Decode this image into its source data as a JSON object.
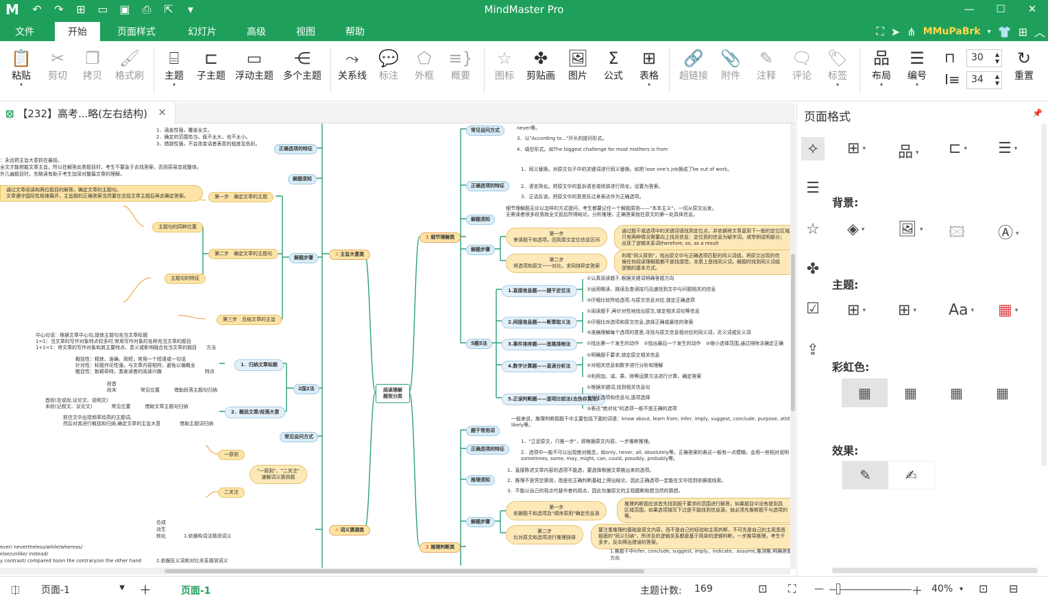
{
  "app": {
    "title": "MindMaster Pro",
    "logo": "M"
  },
  "quick_access": [
    {
      "icon": "undo-icon",
      "glyph": "↶"
    },
    {
      "icon": "redo-icon",
      "glyph": "↷"
    },
    {
      "icon": "new-icon",
      "glyph": "⊞"
    },
    {
      "icon": "open-folder-icon",
      "glyph": "🗀"
    },
    {
      "icon": "save-icon",
      "glyph": "🖫"
    },
    {
      "icon": "print-icon",
      "glyph": "⎙"
    },
    {
      "icon": "export-icon",
      "glyph": "⇱"
    },
    {
      "icon": "more-icon",
      "glyph": "▾"
    }
  ],
  "menu": {
    "file": "文件",
    "home": "开始",
    "page_style": "页面样式",
    "slides": "幻灯片",
    "advanced": "高级",
    "view": "视图",
    "help": "帮助"
  },
  "user": {
    "name": "MMuPaBrk"
  },
  "ribbon": {
    "paste": "粘贴",
    "cut": "剪切",
    "copy": "拷贝",
    "format_painter": "格式刷",
    "topic": "主题",
    "subtopic": "子主题",
    "floating_topic": "浮动主题",
    "multiple_topics": "多个主题",
    "relationship": "关系线",
    "callout": "标注",
    "boundary": "外框",
    "summary": "概要",
    "icon": "图标",
    "clipart": "剪贴画",
    "image": "图片",
    "formula": "公式",
    "table": "表格",
    "hyperlink": "超链接",
    "attachment": "附件",
    "note": "注释",
    "comment": "评论",
    "tag": "标签",
    "layout": "布局",
    "numbering": "编号",
    "spacing_h": "30",
    "spacing_v": "34",
    "reset": "重置"
  },
  "tab": {
    "title": "【232】高考...略(左右结构)"
  },
  "panel": {
    "title": "页面格式",
    "background": "背景:",
    "theme": "主题:",
    "rainbow": "彩虹色:",
    "effects": "效果:"
  },
  "status": {
    "page_name": "页面-1",
    "active_page": "页面-1",
    "topic_count_label": "主题计数:",
    "topic_count": "169",
    "zoom": "40%"
  },
  "mindmap": {
    "center": "阅读理解\n题型分类",
    "left_main": [
      {
        "label": "主旨大意类",
        "num": "3"
      },
      {
        "label": "词义猜测类",
        "num": "4"
      }
    ],
    "right_main": [
      {
        "label": "细节理解类",
        "num": "1"
      },
      {
        "label": "推理判断类",
        "num": "2"
      }
    ],
    "left_nodes": {
      "features": "正确选项的特征",
      "notes": "解题须知",
      "steps": "解题步骤",
      "step1": "第一步　确定文章的主题",
      "step2": "第二步　确定文章的主题句",
      "step3": "第三步　总结文章的主旨",
      "pos4": "主题句的四种位置",
      "feat": "主题句的特征",
      "method22": "2国2法",
      "m1": "1．归纳文章标题",
      "m2": "2．概括文章/段落大意",
      "common": "常见设问方式",
      "one_two": "\"一原则\"、\"二关注\"\n速解词义猜测题",
      "principle": "一原则",
      "focus": "二关注",
      "clue1": "1.依据构词法猜测词义",
      "clue2": "2.依据反义词和对比关系猜测词义"
    },
    "right_nodes": {
      "common": "常见设问方式",
      "features": "正确选项的特征",
      "notes": "解题须知",
      "steps": "解题步骤",
      "s1": "第一步\n审读题干和选项，回到原文定位信息区间",
      "s2": "第二步\n将选项和原文一一对比，求同排异定答案",
      "five": "5题5法",
      "f1": "1.直接信息题——题干定位法",
      "f2": "2.间接信息题——断章取义法",
      "f3": "3.事件排序题——首尾排除法",
      "f4": "4.数字计算题——直读分析法",
      "f5": "5.正误判断题——逐项比较法(去伪存真法)",
      "words": "题干常用词",
      "features2": "正确选项的特征",
      "notes2": "推理须知",
      "steps2": "解题步骤",
      "t1": "第一步\n依据题干和选项及\"顺序原则\"确定信息源",
      "t2": "第二步\n比对原文和选项进行推理抉择"
    },
    "text_snippets": {
      "l1": "1．涵盖性强，覆盖全文。",
      "l2": "2．确定的范围恰当，既不太大，也不太小。",
      "l3": "3．措辞性强，不会改变话者表意的程度及色彩。",
      "l4": "：永远把主旨大意抓在最前。",
      "l5": "全文才能把握文章主旨，所以在解答此类题目时，考生不要急于去找答案，否则容易忽视整体。",
      "l6": "外几遍题目时，先略读有助于考生加深对整篇文章的理解。",
      "l7": "通过文章阅读和两位题目的解答，确定文章的主题句。",
      "l8": "文章遵守国际性规律展开，主旨题的正确答案当然要在总括文章主题后再去确定答案。",
      "l9": "中心句话：根据文章中心句,提炼主题句充当文章标题",
      "l10": "1=1：当文章的写作对象特点较多时,常用写作对象的名称充当文章的题目",
      "l11": "1+1=1：将文章的写作对象和其主要特点、意义或影响融合充当文章的题目　　方法",
      "l12": "概括性：精炼、准确、简短，常用一个短语或一句话",
      "l13": "针对性：标题作论性强，与文章内容相符，避免以偏概全",
      "l14": "醒目性：新颖奇特，激发读者的阅读兴趣　　　　　　　　　特点",
      "l15": "段首　　",
      "l16": "段末　　　　　常见位置　　　借助段落主题句归纳",
      "l17": "首段(总说段,议论文、说明文)",
      "l18": "末段(记叙文、议论文)　　　　常见位置　　　借助文章主题句归纳",
      "l19": "抓住文中出现频率较高的主题词,",
      "l20": "然后对其进行概括和归纳,确定文章的主旨大意　　　　借助主题词归纳",
      "l21": "合成",
      "l22": "派生",
      "l23": "转化",
      "l24": "ever/ nevertheless/while/whereas/",
      "l25": "else/unlike/ instead/",
      "l26": "y contrast/ compared to/on the contrary/on the other hand"
    },
    "right_snippets": {
      "r1": "never等。",
      "r2": "3．以\"According to...\"开头的提问形式。",
      "r3": "4．填空形式。如The biggest challenge for most mothers is from",
      "r4": "1．同义替换。对原文句子中的关键词进行同义替换。如把 lose one's job换成了be out of work。",
      "r5": "2．语言简化。把原文中的复杂语言或修辞进行简化，设置为答案。",
      "r6": "3．正话反说。把原文中的意思反过来表达作为正确选项。",
      "r7": "细节理解题无论以怎样的方式提问，考生都要记住一个解题原则——\"本本主义\"，一切从原文出发。",
      "r8": "无需读者很多段落就全文前后所得结论，分析推理，正确答案就在原文的第一处具体信息。",
      "r9": "①认真阅读题干,根据关键词明确答题方向",
      "r10": "②运用略读、跳读及查读技巧迅速找到文中与问题相关的信息",
      "r11": "③仔细比较所给选项,与原文信息对应,锁定正确选项",
      "r12": "①阅读题干,再针对性地找出原文,锁定相关词句等信息",
      "r13": "②仔细比对选项和原文信息,选择正确或最佳的答案",
      "r14": "③准确理解每个选项的意思,寻找与原文信息相对应的同义词，近义词或反义词",
      "r15": "①找出第一个发生的动作　②找出最后一个发生的动作　③缩小选择范围,通过排除法确定正确",
      "r16": "①明确题干要求,锁定原文相关信息",
      "r17": "②对相关信息和数字进行分析和理解",
      "r18": "③利用加、减、乘、除等运算方法进行计算，确定答案",
      "r19": "①根据关键词,找到相关信息句",
      "r20": "②对比选项和信息句,逐项选择",
      "r21": "③表达\"绝对化\"的选项一般不是正确的选项",
      "r22": "一般来说，推理判断题题干中主要包括下面的词语：know about, learn from, infer, imply, suggest, conclude, purpose, attitu",
      "r23": "likely等。",
      "r24": "1．\"立足原文，只推一步\"，即根据原文内容，一步推断推理。",
      "r25": "2．选项中一般不可以出现绝对概念，如only, never, all, absolutely等，正确答案的表达一般有一点模糊，会用一些相对说明",
      "r26": "sometimes, some, may, might, can, could, possibly, probably等。",
      "r27": "1．直接陈述文章内容的选项不能选，要选择根据文章推出来的选项。",
      "r28": "2．推理不是凭空猜测，而是在正确判断基础上得出结论，因此正确选项一定能在文中找到依据或线索。",
      "r29": "3．不能以自己的观点代替作者的观点，因此勿偏原文的主观臆断和想当然的猜想。",
      "r30": "1.推题干中infer, conclude, suggest, imply，indicate，assume,推测推,明确答题",
      "r31": "方向",
      "r32": "通过题干或选项中的关键词语找到定位点，并依据将文章直到下一般的定位区域出",
      "r33": "只有两种情况需要向上找另信息：定位到的信息为疑字词，或举例说明部分；",
      "r34": "出现了逻辑关系词therefore, so, as a result",
      "r35": "利用\"同义原则\"，找出原文中与正确选项匹配的同义词组，将原文出现的信",
      "r36": "候任何阅读理解题都不是找感觉，本质上是找同义词，解题时找到同义词组",
      "r37": "逻辑的基本方式。",
      "r38": "要注重推理的基础是原文内容，而不是自己的经验和主观判断，不可先是自己的主观意愿",
      "r39": "题面的\"同义归纳\"，所涉及的逻辑关系都是基于简单的逻辑判断，一步推导推理，考生千",
      "r40": "多步，反向得出错误的答案。",
      "r41": "推理判断题应该首先找到题干要求的范围进行解答，如果题目中没有提到具",
      "r42": "区域范围，如果选项描写下过是不能找到信息源，就必须先推断题干与选项的",
      "r43": "等。"
    }
  },
  "colors": {
    "brand": "#1fa05a",
    "user": "#ffd84a",
    "branch": "#2a9f76"
  }
}
